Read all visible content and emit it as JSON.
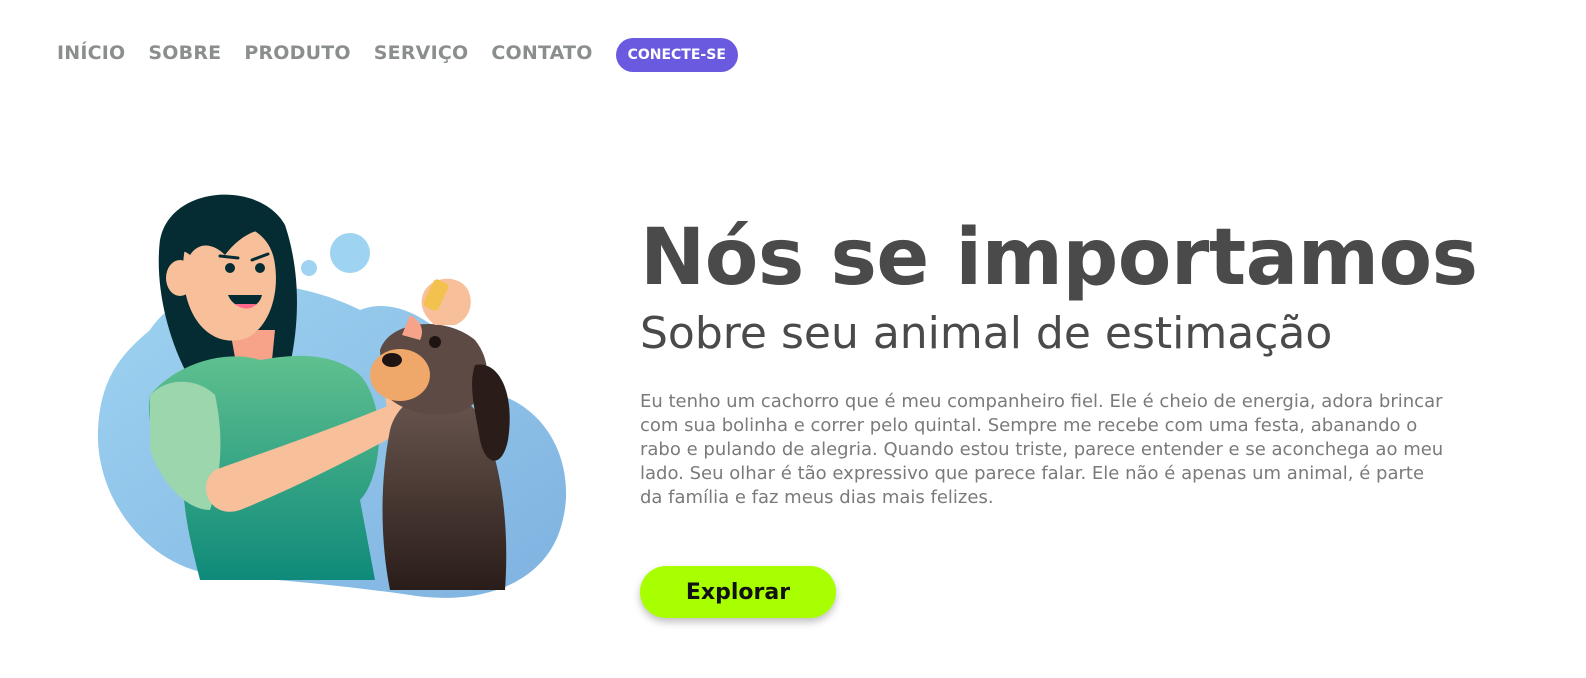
{
  "nav": {
    "items": [
      {
        "label": "INÍCIO"
      },
      {
        "label": "SOBRE"
      },
      {
        "label": "PRODUTO"
      },
      {
        "label": "SERVIÇO"
      },
      {
        "label": "CONTATO"
      }
    ],
    "cta_label": "CONECTE-SE"
  },
  "hero": {
    "title": "Nós se importamos",
    "subtitle": "Sobre seu animal de estimação",
    "paragraph": "Eu tenho um cachorro que é meu companheiro fiel. Ele é cheio de energia, adora brincar com sua bolinha e correr pelo quintal. Sempre me recebe com uma festa, abanando o rabo e pulando de alegria. Quando estou triste, parece entender e se aconchega ao meu lado. Seu olhar é tão expressivo que parece falar. Ele não é apenas um animal, é parte da família e faz meus dias mais felizes.",
    "button_label": "Explorar"
  },
  "colors": {
    "accent_purple": "#6a5ae0",
    "button_green": "#a8ff00",
    "heading_gray": "#4a4a4a",
    "nav_gray": "#8a8f8c"
  },
  "illustration": {
    "icon": "woman-giving-dog-eye-drops-illustration"
  }
}
